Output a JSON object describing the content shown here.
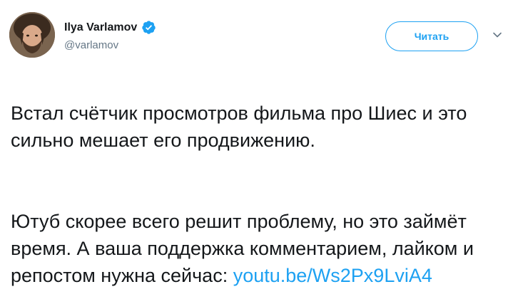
{
  "author": {
    "display_name": "Ilya Varlamov",
    "screen_name": "@varlamov",
    "verified": true
  },
  "follow_button": {
    "label": "Читать"
  },
  "icons": {
    "verified": "verified-badge-icon",
    "caret": "chevron-down-icon",
    "avatar": "avatar"
  },
  "tweet": {
    "paragraph_1": "Встал счётчик просмотров фильма про Шиес и это сильно мешает его продвижению.",
    "paragraph_2_text": "Ютуб скорее всего решит проблему, но это займёт время. А ваша поддержка комментарием, лайком и репостом нужна сейчас: ",
    "link_text": "youtu.be/Ws2Px9LviA4"
  },
  "colors": {
    "accent": "#1da1f2",
    "text": "#14171a",
    "muted": "#657786"
  }
}
